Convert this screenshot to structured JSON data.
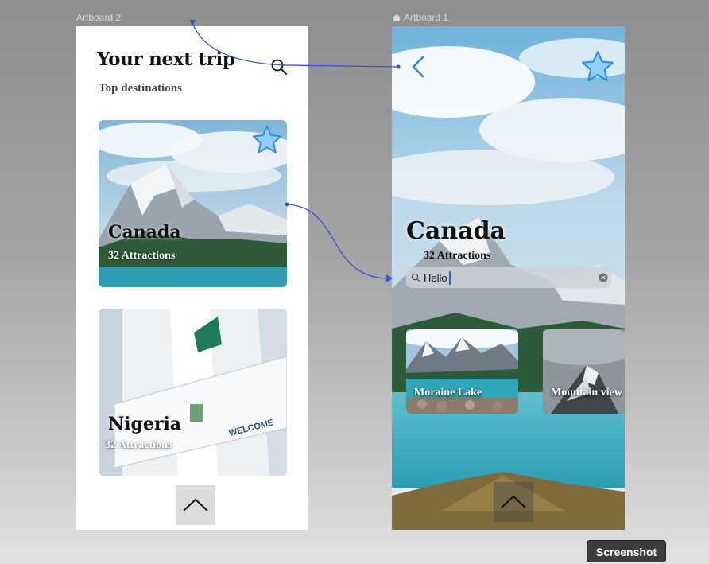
{
  "canvas": {
    "artboard2_label": "Artboard 2",
    "artboard1_label": "Artboard 1"
  },
  "artboard2": {
    "title": "Your next trip",
    "subtitle": "Top destinations",
    "cards": [
      {
        "name": "Canada",
        "attractions": "32 Attractions"
      },
      {
        "name": "Nigeria",
        "attractions": "32 Attractions",
        "sign_text": "WELCOME"
      }
    ]
  },
  "artboard1": {
    "title": "Canada",
    "attractions": "32 Attractions",
    "search_value": "Hello",
    "thumbnails": [
      {
        "label": "Moraine Lake"
      },
      {
        "label": "Mountain view"
      }
    ]
  },
  "toolbar": {
    "screenshot_label": "Screenshot"
  },
  "colors": {
    "accent_blue": "#3a9ff0",
    "star_fill": "#8fd0ff",
    "connector": "#3b4fd6",
    "lake": "#3aa7b8"
  },
  "icons": [
    "home-icon",
    "search-icon",
    "star-icon",
    "back-chevron-icon",
    "chevron-up-icon",
    "clear-icon"
  ]
}
